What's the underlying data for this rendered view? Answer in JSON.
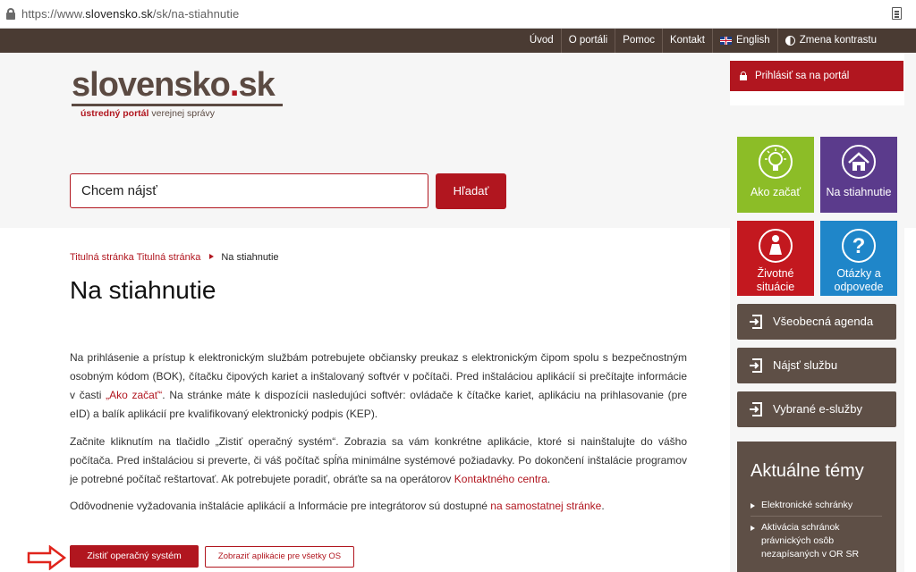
{
  "browser": {
    "url_prefix": "https://www.",
    "url_domain": "slovensko.sk",
    "url_path": "/sk/na-stiahnutie"
  },
  "topnav": {
    "items": [
      "Úvod",
      "O portáli",
      "Pomoc",
      "Kontakt",
      "English",
      "Zmena kontrastu"
    ]
  },
  "logo": {
    "name_main": "slovensko",
    "name_dot": ".",
    "name_tld": "sk",
    "tag_bold": "ústredný portál",
    "tag_rest": " verejnej správy"
  },
  "search": {
    "value": "Chcem nájsť",
    "button": "Hľadať"
  },
  "login": {
    "label": "Prihlásiť sa na portál"
  },
  "tiles": [
    {
      "label": "Ako začať",
      "color": "#8cbd27"
    },
    {
      "label": "Na stiahnutie",
      "color": "#5b3b8c"
    },
    {
      "label": "Životné situácie",
      "label_l1": "Životné",
      "label_l2": "situácie",
      "color": "#c3181f"
    },
    {
      "label": "Otázky a odpovede",
      "label_l1": "Otázky a",
      "label_l2": "odpovede",
      "color": "#1f86c9"
    }
  ],
  "side_buttons": [
    "Všeobecná agenda",
    "Nájsť službu",
    "Vybrané e-služby"
  ],
  "topics": {
    "title": "Aktuálne témy",
    "items": [
      "Elektronické schránky",
      "Aktivácia schránok právnických osôb nezapísaných v OR SR"
    ]
  },
  "breadcrumb": {
    "home": "Titulná stránka Titulná stránka",
    "current": "Na stiahnutie"
  },
  "page": {
    "title": "Na stiahnutie",
    "p1_a": "Na prihlásenie a prístup k elektronickým službám potrebujete občiansky preukaz s elektronickým čipom spolu s bezpečnostným osobným kódom (BOK), čítačku čipových kariet a inštalovaný softvér v počítači. Pred inštaláciou aplikácií si prečítajte informácie v časti ",
    "p1_link": "„Ako začať“",
    "p1_b": ". Na stránke máte k dispozícii nasledujúci softvér: ovládače k čítačke kariet, aplikáciu na prihlasovanie (pre eID) a balík aplikácií pre kvalifikovaný elektronický podpis (KEP).",
    "p2_a": "Začnite kliknutím na tlačidlo „Zistiť operačný systém“. Zobrazia sa vám konkrétne aplikácie, ktoré si nainštalujte do vášho počítača. Pred inštaláciou si preverte, či váš počítač spĺňa minimálne systémové požiadavky. Po dokončení inštalácie programov je potrebné počítač reštartovať. Ak potrebujete poradiť, obráťte sa na operátorov ",
    "p2_link": "Kontaktného centra",
    "p2_b": ".",
    "p3_a": "Odôvodnenie vyžadovania inštalácie aplikácií a Informácie pre integrátorov sú dostupné ",
    "p3_link": "na samostatnej stránke",
    "p3_b": ".",
    "btn_detect": "Zistiť operačný systém",
    "btn_all": "Zobraziť aplikácie pre všetky OS"
  },
  "colors": {
    "brand_red": "#b1161f",
    "brown": "#5e4f46",
    "nav_dark": "#4a3b33",
    "arrow_red": "#e0241c"
  }
}
